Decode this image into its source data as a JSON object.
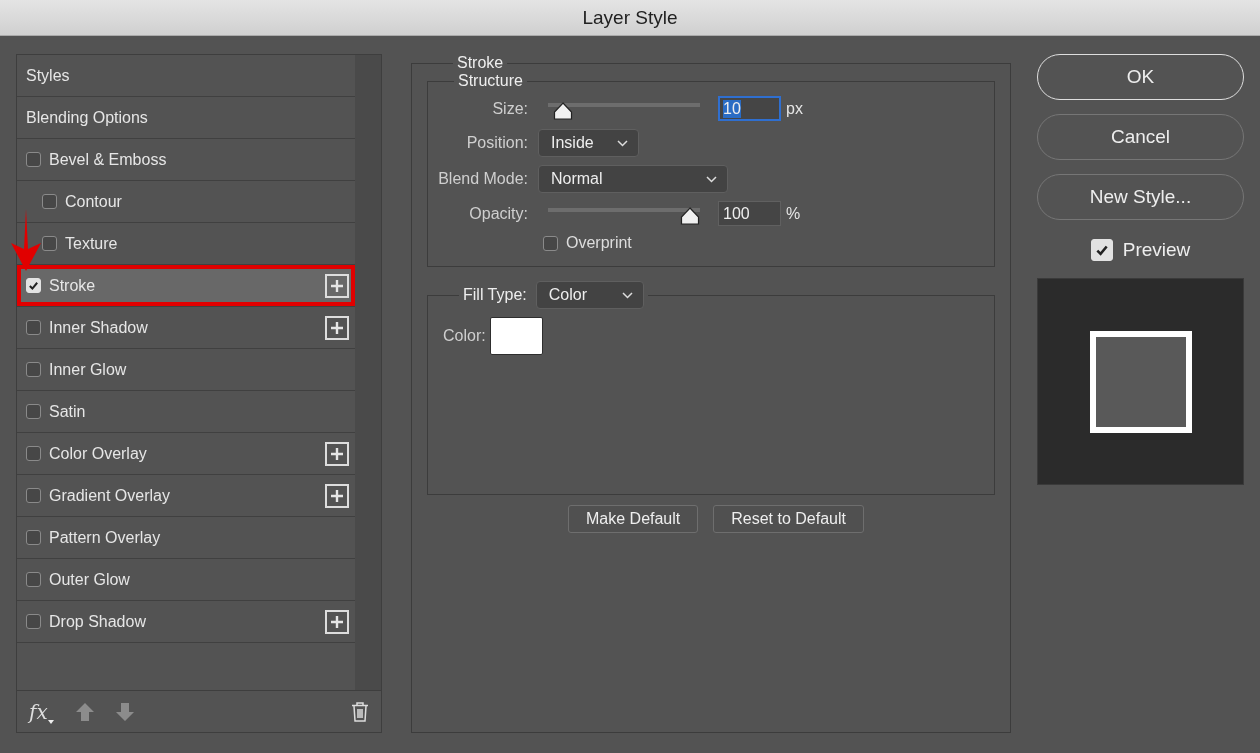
{
  "window": {
    "title": "Layer Style"
  },
  "styles_list": {
    "items": [
      {
        "kind": "header",
        "label": "Styles",
        "selected": false,
        "highlighted": false
      },
      {
        "kind": "header",
        "label": "Blending Options",
        "selected": false,
        "highlighted": false
      },
      {
        "kind": "effect",
        "label": "Bevel & Emboss",
        "checked": false,
        "addable": false,
        "selected": false,
        "highlighted": false,
        "children": [
          {
            "kind": "effect",
            "label": "Contour",
            "checked": false,
            "addable": false,
            "selected": false,
            "highlighted": false
          },
          {
            "kind": "effect",
            "label": "Texture",
            "checked": false,
            "addable": false,
            "selected": false,
            "highlighted": false
          }
        ]
      },
      {
        "kind": "effect",
        "label": "Stroke",
        "checked": true,
        "addable": true,
        "selected": true,
        "highlighted": true
      },
      {
        "kind": "effect",
        "label": "Inner Shadow",
        "checked": false,
        "addable": true,
        "selected": false,
        "highlighted": false
      },
      {
        "kind": "effect",
        "label": "Inner Glow",
        "checked": false,
        "addable": false,
        "selected": false,
        "highlighted": false
      },
      {
        "kind": "effect",
        "label": "Satin",
        "checked": false,
        "addable": false,
        "selected": false,
        "highlighted": false
      },
      {
        "kind": "effect",
        "label": "Color Overlay",
        "checked": false,
        "addable": true,
        "selected": false,
        "highlighted": false
      },
      {
        "kind": "effect",
        "label": "Gradient Overlay",
        "checked": false,
        "addable": true,
        "selected": false,
        "highlighted": false
      },
      {
        "kind": "effect",
        "label": "Pattern Overlay",
        "checked": false,
        "addable": false,
        "selected": false,
        "highlighted": false
      },
      {
        "kind": "effect",
        "label": "Outer Glow",
        "checked": false,
        "addable": false,
        "selected": false,
        "highlighted": false
      },
      {
        "kind": "effect",
        "label": "Drop Shadow",
        "checked": false,
        "addable": true,
        "selected": false,
        "highlighted": false
      }
    ],
    "toolbar": {
      "fx_label": "fx",
      "move_up_disabled": true,
      "move_down_disabled": true
    }
  },
  "stroke_panel": {
    "title": "Stroke",
    "structure": {
      "title": "Structure",
      "size": {
        "label": "Size:",
        "value": "10",
        "unit": "px",
        "level": 0.04,
        "focused": true
      },
      "position": {
        "label": "Position:",
        "value": "Inside"
      },
      "blend_mode": {
        "label": "Blend Mode:",
        "value": "Normal"
      },
      "opacity": {
        "label": "Opacity:",
        "value": "100",
        "unit": "%",
        "level": 1,
        "focused": false
      },
      "overprint": {
        "label": "Overprint",
        "checked": false
      }
    },
    "fill_type": {
      "label": "Fill Type:",
      "value": "Color",
      "color_label": "Color:",
      "color": "#ffffff"
    },
    "buttons": [
      "Make Default",
      "Reset to Default"
    ]
  },
  "actions": {
    "buttons": [
      {
        "label": "OK",
        "primary": true
      },
      {
        "label": "Cancel",
        "primary": false
      },
      {
        "label": "New Style...",
        "primary": false
      }
    ],
    "preview": {
      "label": "Preview",
      "checked": true
    }
  }
}
